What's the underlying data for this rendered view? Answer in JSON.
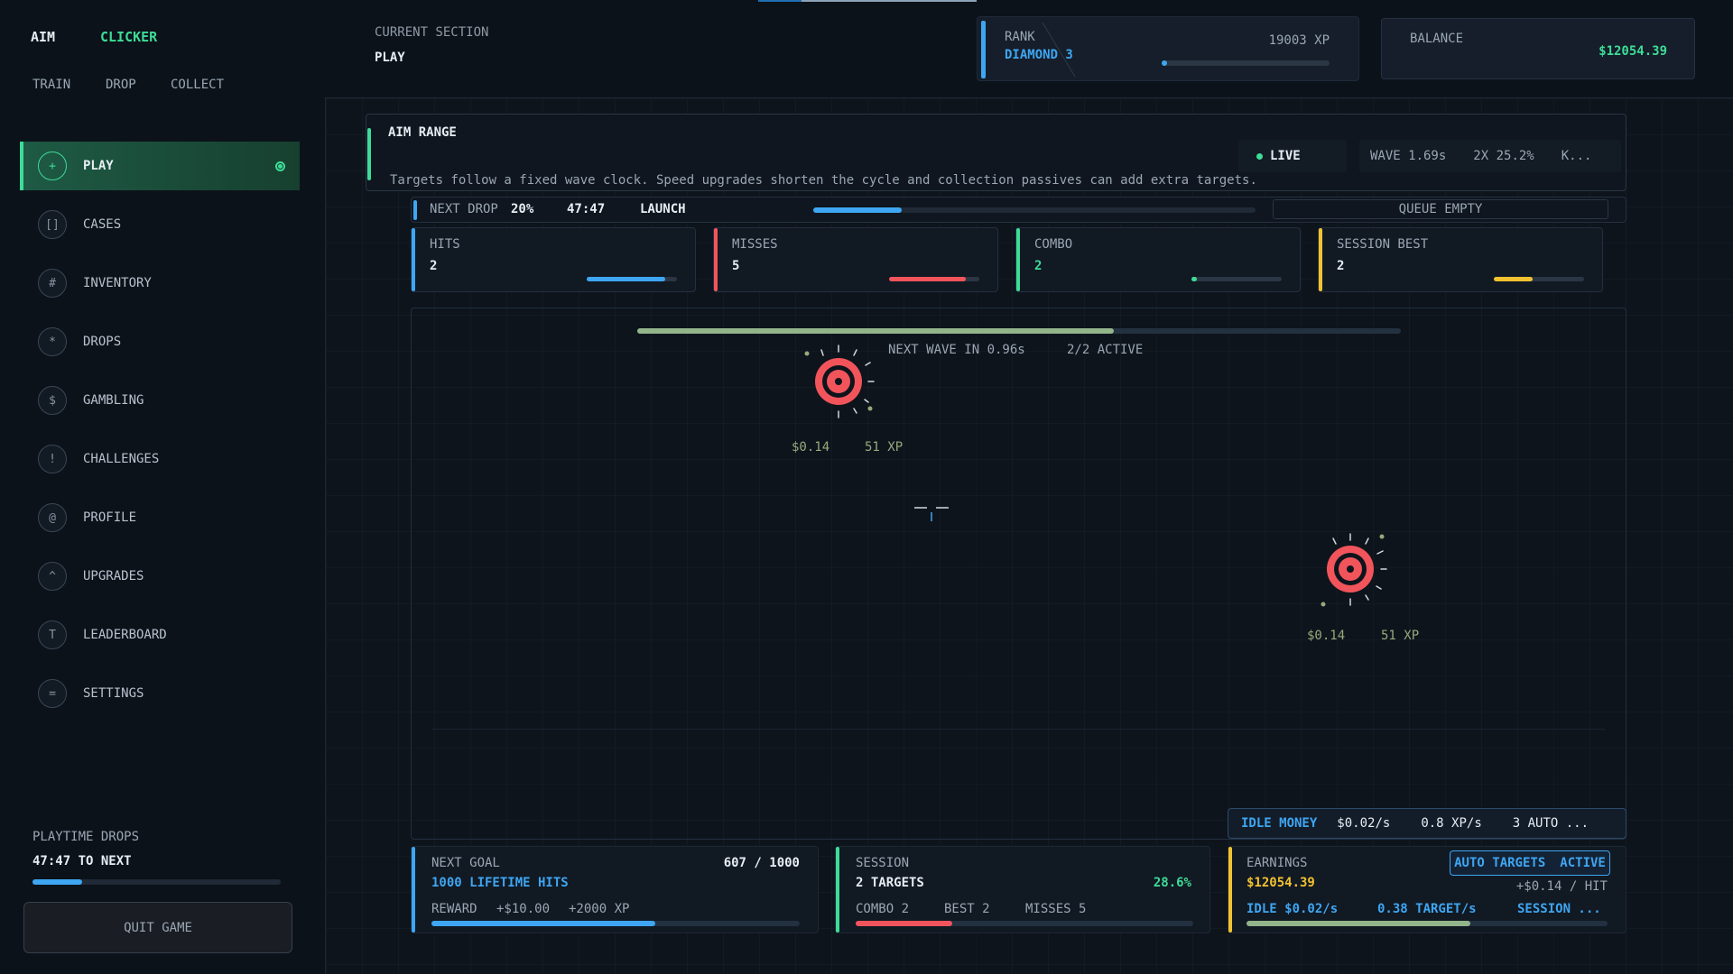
{
  "brand": {
    "part1": "AIM",
    "part2": "CLICKER"
  },
  "subnav": [
    "TRAIN",
    "DROP",
    "COLLECT"
  ],
  "sidebar": {
    "items": [
      {
        "icon": "+",
        "label": "PLAY",
        "active": true
      },
      {
        "icon": "[]",
        "label": "CASES"
      },
      {
        "icon": "#",
        "label": "INVENTORY"
      },
      {
        "icon": "*",
        "label": "DROPS"
      },
      {
        "icon": "$",
        "label": "GAMBLING"
      },
      {
        "icon": "!",
        "label": "CHALLENGES"
      },
      {
        "icon": "@",
        "label": "PROFILE"
      },
      {
        "icon": "^",
        "label": "UPGRADES"
      },
      {
        "icon": "T",
        "label": "LEADERBOARD"
      },
      {
        "icon": "=",
        "label": "SETTINGS"
      }
    ],
    "playtime": {
      "title": "PLAYTIME DROPS",
      "time": "47:47 TO NEXT",
      "progress": 0.2
    },
    "quit_label": "QUIT GAME"
  },
  "header": {
    "section_label": "CURRENT SECTION",
    "section_value": "PLAY",
    "rank_label": "RANK",
    "rank_value": "DIAMOND 3",
    "xp": "19003 XP",
    "rank_progress": 0.03,
    "balance_label": "BALANCE",
    "balance_value": "$12054.39"
  },
  "range": {
    "title": "AIM RANGE",
    "description": "Targets follow a fixed wave clock. Speed upgrades shorten the cycle and collection passives can add extra targets.",
    "live": "LIVE",
    "wave": [
      "WAVE 1.69s",
      "2X 25.2%",
      "K..."
    ]
  },
  "drop": {
    "label": "NEXT DROP",
    "percent": "20%",
    "time": "47:47",
    "launch": "LAUNCH",
    "progress": 0.2,
    "queue": "QUEUE EMPTY"
  },
  "stats": [
    {
      "label": "HITS",
      "value": "2",
      "color": "#3ea6f2",
      "progress": 0.87,
      "valueColor": "#e6edf3"
    },
    {
      "label": "MISSES",
      "value": "5",
      "color": "#f2545b",
      "progress": 0.85,
      "valueColor": "#e6edf3"
    },
    {
      "label": "COMBO",
      "value": "2",
      "color": "#3ddc97",
      "progress": 0.06,
      "valueColor": "#3ddc97"
    },
    {
      "label": "SESSION BEST",
      "value": "2",
      "color": "#f2c230",
      "progress": 0.43,
      "valueColor": "#e6edf3"
    }
  ],
  "arena": {
    "wave_progress": 0.624,
    "next_wave": "NEXT WAVE IN 0.96s",
    "active": "2/2 ACTIVE",
    "targets": [
      {
        "money": "$0.14",
        "xp": "51 XP"
      },
      {
        "money": "$0.14",
        "xp": "51 XP"
      }
    ]
  },
  "idle": {
    "label": "IDLE MONEY",
    "money": "$0.02/s",
    "xp": "0.8 XP/s",
    "auto": "3 AUTO ..."
  },
  "goal": {
    "label": "NEXT GOAL",
    "count": "607 / 1000",
    "title": "1000 LIFETIME HITS",
    "reward_label": "REWARD",
    "reward_money": "+$10.00",
    "reward_xp": "+2000 XP",
    "progress": 0.607
  },
  "session": {
    "label": "SESSION",
    "targets": "2 TARGETS",
    "accuracy": "28.6%",
    "combo": "COMBO 2",
    "best": "BEST 2",
    "misses": "MISSES 5",
    "progress": 0.286
  },
  "earnings": {
    "label": "EARNINGS",
    "auto": "AUTO TARGETS",
    "active": "ACTIVE",
    "value": "$12054.39",
    "per_hit": "+$0.14 / HIT",
    "idle": "IDLE $0.02/s",
    "target_rate": "0.38 TARGET/s",
    "session": "SESSION ...",
    "progress": 0.62
  }
}
